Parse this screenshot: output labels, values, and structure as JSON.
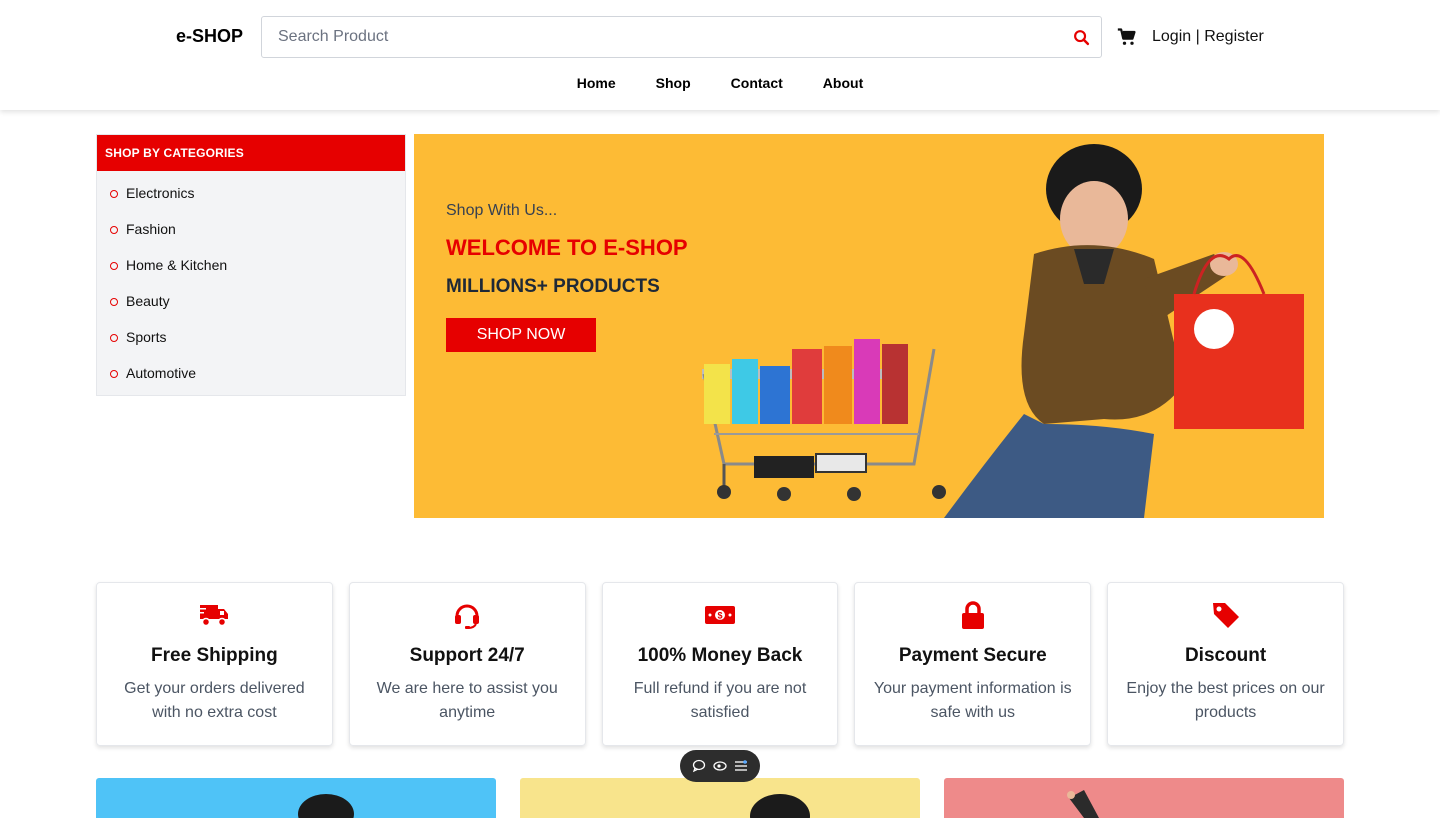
{
  "header": {
    "logo": "e-SHOP",
    "search_placeholder": "Search Product",
    "login": "Login",
    "separator": "|",
    "register": "Register",
    "nav": [
      "Home",
      "Shop",
      "Contact",
      "About"
    ]
  },
  "sidebar": {
    "title": "SHOP BY CATEGORIES",
    "items": [
      "Electronics",
      "Fashion",
      "Home & Kitchen",
      "Beauty",
      "Sports",
      "Automotive"
    ]
  },
  "hero": {
    "subtitle": "Shop With Us...",
    "title": "WELCOME TO E-SHOP",
    "tagline": "MILLIONS+ PRODUCTS",
    "button": "SHOP NOW",
    "bg_color": "#fdbb35"
  },
  "features": [
    {
      "icon": "truck-icon",
      "title": "Free Shipping",
      "text": "Get your orders delivered with no extra cost"
    },
    {
      "icon": "headset-icon",
      "title": "Support 24/7",
      "text": "We are here to assist you anytime"
    },
    {
      "icon": "money-icon",
      "title": "100% Money Back",
      "text": "Full refund if you are not satisfied"
    },
    {
      "icon": "lock-icon",
      "title": "Payment Secure",
      "text": "Your payment information is safe with us"
    },
    {
      "icon": "tag-icon",
      "title": "Discount",
      "text": "Enjoy the best prices on our products"
    }
  ],
  "colors": {
    "accent": "#e60000",
    "banner_blue": "#4fc3f7",
    "banner_yellow": "#f8e48c",
    "banner_pink": "#ee8a8a"
  }
}
